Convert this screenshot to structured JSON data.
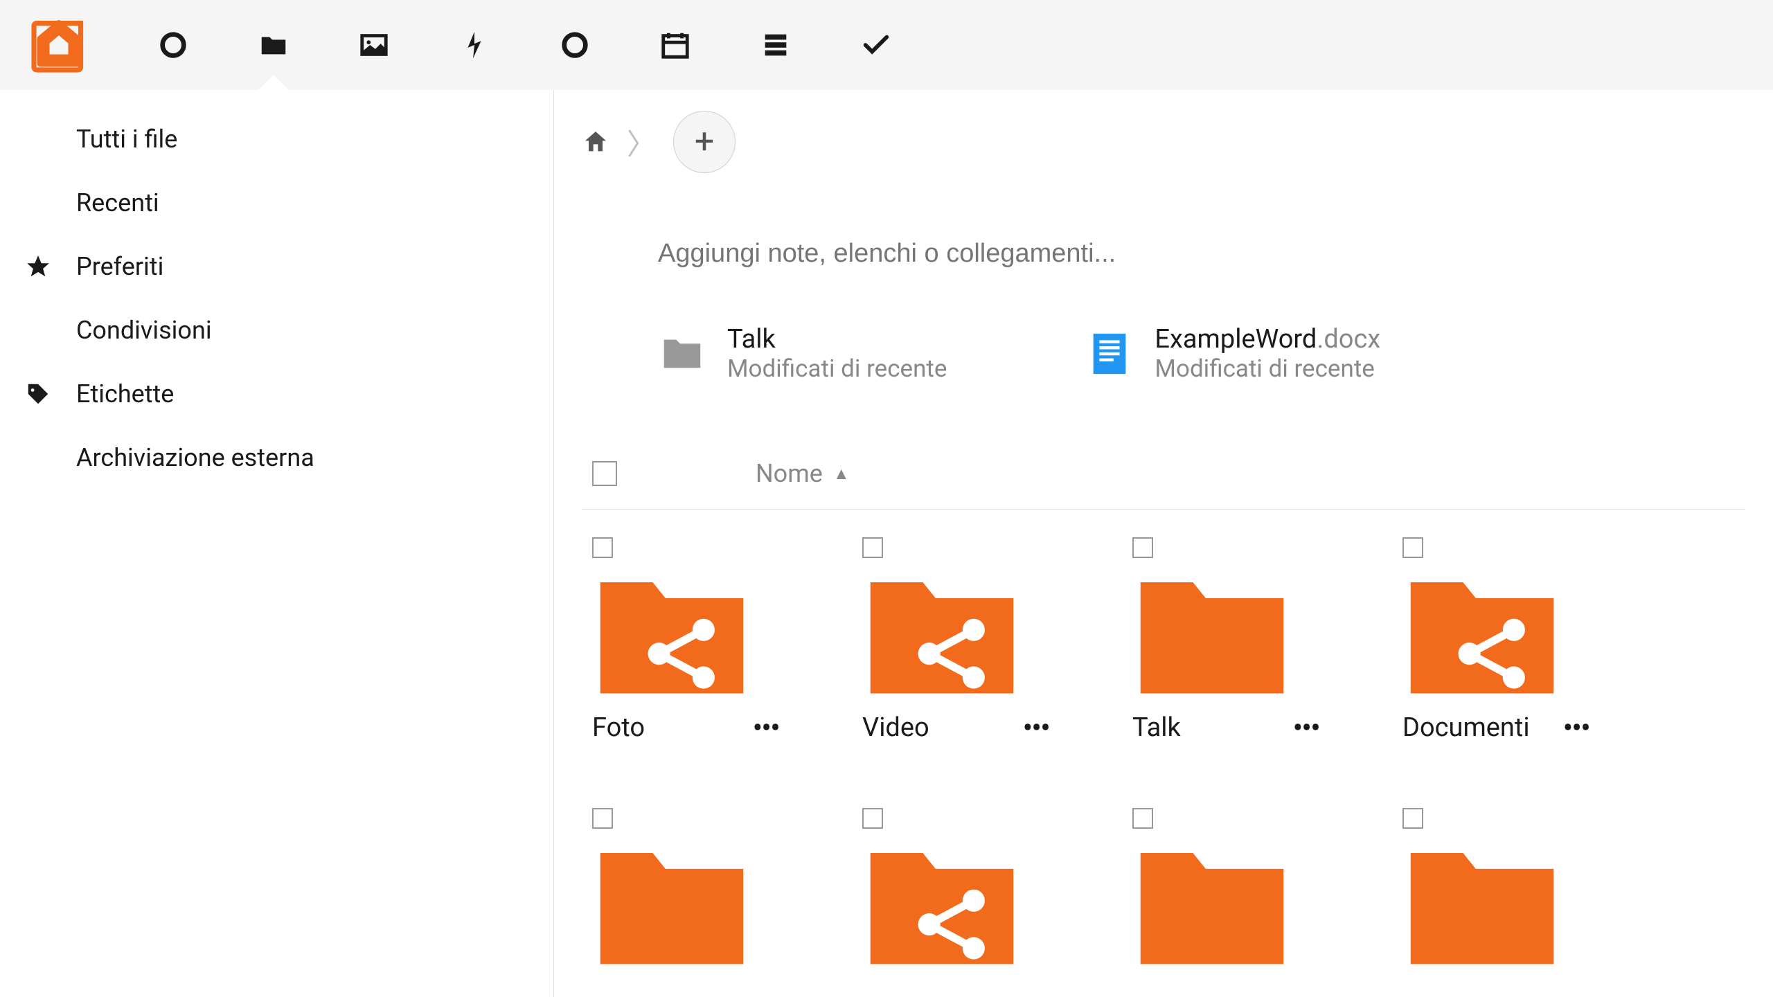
{
  "accent_color": "#f26b1d",
  "topbar": {
    "apps": [
      "dashboard",
      "files",
      "gallery",
      "activity",
      "talk",
      "calendar",
      "deck",
      "tasks"
    ]
  },
  "sidebar": {
    "items": [
      {
        "id": "all-files",
        "label": "Tutti i file",
        "icon": null,
        "active": true
      },
      {
        "id": "recent",
        "label": "Recenti",
        "icon": null
      },
      {
        "id": "favorites",
        "label": "Preferiti",
        "icon": "star"
      },
      {
        "id": "shares",
        "label": "Condivisioni",
        "icon": null
      },
      {
        "id": "tags",
        "label": "Etichette",
        "icon": "tag"
      },
      {
        "id": "external",
        "label": "Archiviazione esterna",
        "icon": null
      }
    ]
  },
  "content": {
    "notes_placeholder": "Aggiungi note, elenchi o collegamenti...",
    "recent": [
      {
        "name": "Talk",
        "ext": "",
        "subtitle": "Modificati di recente",
        "type": "folder"
      },
      {
        "name": "ExampleWord",
        "ext": ".docx",
        "subtitle": "Modificati di recente",
        "type": "doc"
      }
    ],
    "columns": {
      "name": "Nome"
    },
    "folders": [
      {
        "name": "Foto",
        "shared": true
      },
      {
        "name": "Video",
        "shared": true
      },
      {
        "name": "Talk",
        "shared": false
      },
      {
        "name": "Documenti",
        "shared": true
      },
      {
        "name": "",
        "shared": false
      },
      {
        "name": "",
        "shared": true
      },
      {
        "name": "",
        "shared": false
      },
      {
        "name": "",
        "shared": false
      }
    ]
  }
}
